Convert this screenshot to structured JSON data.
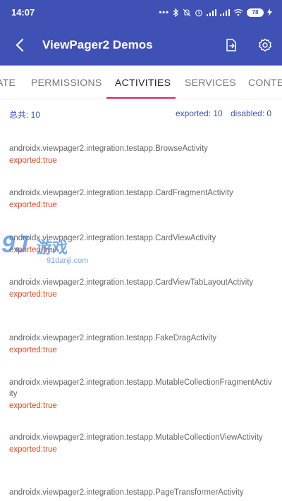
{
  "status_bar": {
    "time": "14:07",
    "battery": "78",
    "dots": "•••"
  },
  "app_bar": {
    "title": "ViewPager2 Demos"
  },
  "tabs": [
    {
      "label": "ATE"
    },
    {
      "label": "PERMISSIONS"
    },
    {
      "label": "ACTIVITIES"
    },
    {
      "label": "SERVICES"
    },
    {
      "label": "CONTENT"
    }
  ],
  "summary": {
    "total": "总共: 10",
    "exported": "exported: 10",
    "disabled": "disabled: 0"
  },
  "items": [
    {
      "name": "androidx.viewpager2.integration.testapp.BrowseActivity",
      "status": "exported:true"
    },
    {
      "name": "androidx.viewpager2.integration.testapp.CardFragmentActivity",
      "status": "exported:true"
    },
    {
      "name": "androidx.viewpager2.integration.testapp.CardViewActivity",
      "status": "exported:true"
    },
    {
      "name": "androidx.viewpager2.integration.testapp.CardViewTabLayoutActivity",
      "status": "exported:true"
    },
    {
      "name": "androidx.viewpager2.integration.testapp.FakeDragActivity",
      "status": "exported:true"
    },
    {
      "name": "androidx.viewpager2.integration.testapp.MutableCollectionFragmentActivity",
      "status": "exported:true"
    },
    {
      "name": "androidx.viewpager2.integration.testapp.MutableCollectionViewActivity",
      "status": "exported:true"
    },
    {
      "name": "androidx.viewpager2.integration.testapp.PageTransformerActivity",
      "status": ""
    }
  ],
  "watermark": {
    "logo": "9J",
    "cn": "游戏",
    "site": "91danji.com"
  },
  "colors": {
    "primary": "#3f51b5",
    "accent": "#e91e63",
    "exported": "#e64a19"
  }
}
